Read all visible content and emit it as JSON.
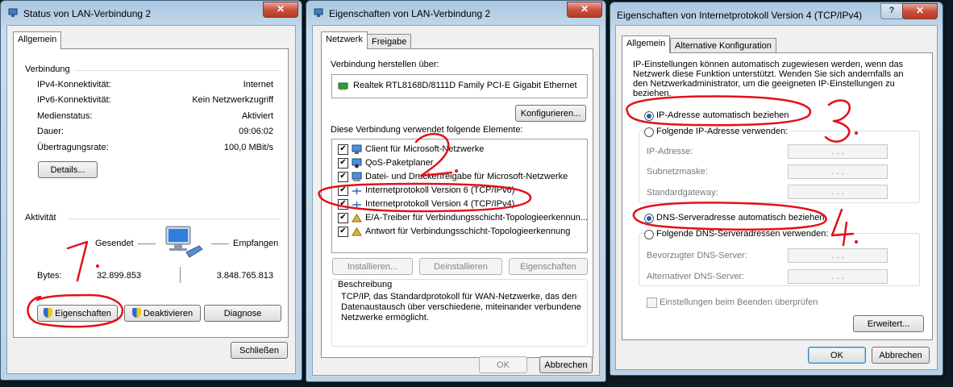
{
  "win1": {
    "title": "Status von LAN-Verbindung 2",
    "tab": "Allgemein",
    "connection_heading": "Verbindung",
    "rows": [
      {
        "label": "IPv4-Konnektivität:",
        "value": "Internet"
      },
      {
        "label": "IPv6-Konnektivität:",
        "value": "Kein Netzwerkzugriff"
      },
      {
        "label": "Medienstatus:",
        "value": "Aktiviert"
      },
      {
        "label": "Dauer:",
        "value": "09:06:02"
      },
      {
        "label": "Übertragungsrate:",
        "value": "100,0 MBit/s"
      }
    ],
    "details_button": "Details...",
    "activity_heading": "Aktivität",
    "sent_label": "Gesendet",
    "received_label": "Empfangen",
    "bytes_label": "Bytes:",
    "bytes_sent": "32.899.853",
    "bytes_received": "3.848.765.813",
    "properties_button": "Eigenschaften",
    "deactivate_button": "Deaktivieren",
    "diagnose_button": "Diagnose",
    "close_button": "Schließen"
  },
  "win2": {
    "title": "Eigenschaften von LAN-Verbindung 2",
    "tabs": [
      "Netzwerk",
      "Freigabe"
    ],
    "connect_via_label": "Verbindung herstellen über:",
    "adapter_name": "Realtek RTL8168D/8111D Family PCI-E Gigabit Ethernet",
    "configure_button": "Konfigurieren...",
    "elements_label": "Diese Verbindung verwendet folgende Elemente:",
    "items": [
      {
        "label": "Client für Microsoft-Netzwerke"
      },
      {
        "label": "QoS-Paketplaner"
      },
      {
        "label": "Datei- und Druckerfreigabe für Microsoft-Netzwerke"
      },
      {
        "label": "Internetprotokoll Version 6 (TCP/IPv6)"
      },
      {
        "label": "Internetprotokoll Version 4 (TCP/IPv4)"
      },
      {
        "label": "E/A-Treiber für Verbindungsschicht-Topologieerkennun..."
      },
      {
        "label": "Antwort für Verbindungsschicht-Topologieerkennung"
      }
    ],
    "install_button": "Installieren...",
    "uninstall_button": "Deinstallieren",
    "properties_button": "Eigenschaften",
    "description_heading": "Beschreibung",
    "description_text": "TCP/IP, das Standardprotokoll für WAN-Netzwerke, das den Datenaustausch über verschiedene, miteinander verbundene Netzwerke ermöglicht.",
    "ok_button": "OK",
    "cancel_button": "Abbrechen"
  },
  "win3": {
    "title": "Eigenschaften von Internetprotokoll Version 4 (TCP/IPv4)",
    "tabs": [
      "Allgemein",
      "Alternative Konfiguration"
    ],
    "intro": "IP-Einstellungen können automatisch zugewiesen werden, wenn das Netzwerk diese Funktion unterstützt. Wenden Sie sich andernfalls an den Netzwerkadministrator, um die geeigneten IP-Einstellungen zu beziehen.",
    "ip_auto": "IP-Adresse automatisch beziehen",
    "ip_manual": "Folgende IP-Adresse verwenden:",
    "ip_address_label": "IP-Adresse:",
    "subnet_label": "Subnetzmaske:",
    "gateway_label": "Standardgateway:",
    "dns_auto": "DNS-Serveradresse automatisch beziehen",
    "dns_manual": "Folgende DNS-Serveradressen verwenden:",
    "dns_preferred_label": "Bevorzugter DNS-Server:",
    "dns_alternate_label": "Alternativer DNS-Server:",
    "validate_label": "Einstellungen beim Beenden überprüfen",
    "advanced_button": "Erweitert...",
    "ok_button": "OK",
    "cancel_button": "Abbrechen",
    "ip_dots": ". . ."
  },
  "annotations": [
    "1.",
    "2.",
    "3.",
    "4."
  ],
  "colors": {
    "annotation": "#e3101b",
    "radio_on": "#1d5fb3"
  }
}
